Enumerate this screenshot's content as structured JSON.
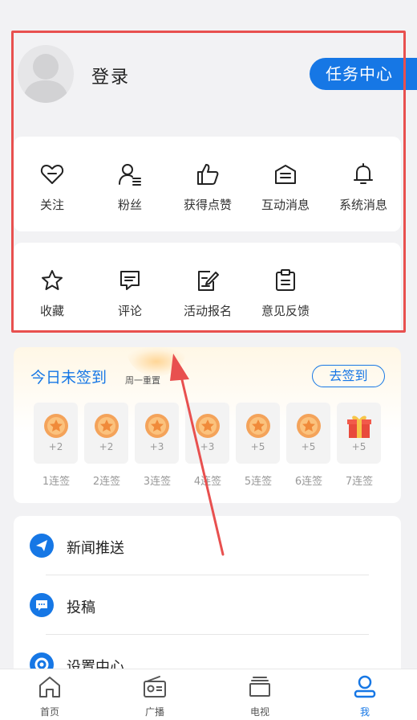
{
  "profile": {
    "login_label": "登录",
    "task_center_label": "任务中心"
  },
  "grid_primary": [
    {
      "label": "关注",
      "icon": "heart-minus-icon"
    },
    {
      "label": "粉丝",
      "icon": "user-list-icon"
    },
    {
      "label": "获得点赞",
      "icon": "thumbs-up-icon"
    },
    {
      "label": "互动消息",
      "icon": "inbox-icon"
    },
    {
      "label": "系统消息",
      "icon": "bell-icon"
    }
  ],
  "grid_secondary": [
    {
      "label": "收藏",
      "icon": "star-icon"
    },
    {
      "label": "评论",
      "icon": "comment-icon"
    },
    {
      "label": "活动报名",
      "icon": "edit-form-icon"
    },
    {
      "label": "意见反馈",
      "icon": "clipboard-icon"
    }
  ],
  "signin": {
    "title": "今日未签到",
    "subtitle": "周一重置",
    "button_label": "去签到",
    "days": [
      {
        "points": "+2",
        "label": "1连签",
        "reward": "coin"
      },
      {
        "points": "+2",
        "label": "2连签",
        "reward": "coin"
      },
      {
        "points": "+3",
        "label": "3连签",
        "reward": "coin"
      },
      {
        "points": "+3",
        "label": "4连签",
        "reward": "coin"
      },
      {
        "points": "+5",
        "label": "5连签",
        "reward": "coin"
      },
      {
        "points": "+5",
        "label": "6连签",
        "reward": "coin"
      },
      {
        "points": "+5",
        "label": "7连签",
        "reward": "gift"
      }
    ]
  },
  "menu": [
    {
      "label": "新闻推送",
      "icon": "send-icon"
    },
    {
      "label": "投稿",
      "icon": "chat-bubble-icon"
    },
    {
      "label": "设置中心",
      "icon": "settings-icon"
    }
  ],
  "tabbar": [
    {
      "label": "首页",
      "icon": "home-icon",
      "active": false
    },
    {
      "label": "广播",
      "icon": "radio-icon",
      "active": false
    },
    {
      "label": "电视",
      "icon": "tv-icon",
      "active": false
    },
    {
      "label": "我",
      "icon": "user-icon",
      "active": true
    }
  ],
  "colors": {
    "accent": "#1677e5",
    "annotation": "#e8504f",
    "coin": "#f4a35a"
  }
}
